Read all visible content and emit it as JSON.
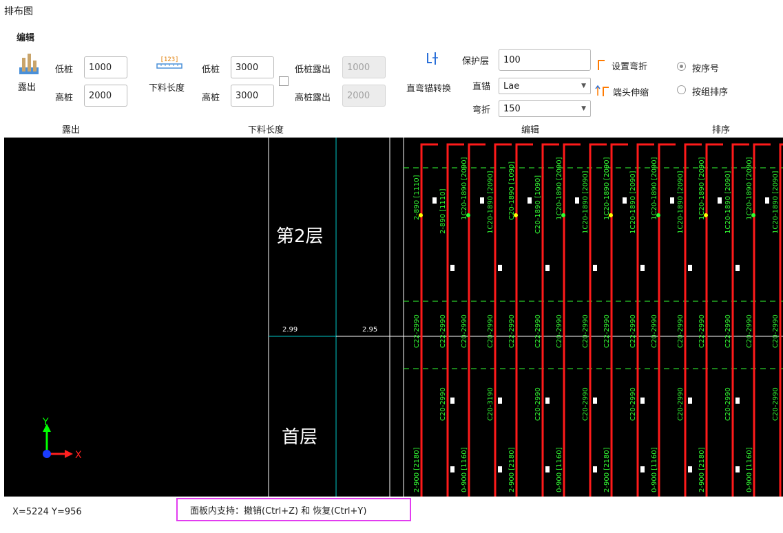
{
  "window": {
    "title": "排布图"
  },
  "ribbon": {
    "tab_label": "编辑",
    "expose_group": {
      "button_label": "露出",
      "low_pile_label": "低桩",
      "low_pile_value": "1000",
      "high_pile_label": "高桩",
      "high_pile_value": "2000",
      "caption": "露出"
    },
    "cut_length_group": {
      "button_label": "下料长度",
      "icon_digits": "[123]",
      "low_pile_label": "低桩",
      "low_pile_value": "3000",
      "high_pile_label": "高桩",
      "high_pile_value": "3000",
      "low_expose_label": "低桩露出",
      "low_expose_value": "1000",
      "high_expose_label": "高桩露出",
      "high_expose_value": "2000",
      "caption": "下料长度"
    },
    "edit_group": {
      "convert_label": "直弯锚转换",
      "cover_label": "保护层",
      "cover_value": "100",
      "straight_anchor_label": "直锚",
      "straight_anchor_value": "Lae",
      "bend_label": "弯折",
      "bend_value": "150",
      "set_bend_label": "设置弯折",
      "end_stretch_label": "端头伸缩",
      "caption": "编辑"
    },
    "sort_group": {
      "option_by_number": "按序号",
      "option_by_group": "按组排序",
      "selected": "按序号",
      "caption": "排序"
    }
  },
  "canvas": {
    "floor_upper": "第2层",
    "floor_lower": "首层",
    "elev_left": "2.99",
    "elev_right": "2.95",
    "axis_x": "X",
    "axis_y": "Y",
    "colors": {
      "bar": "#ff1a1a",
      "text": "#33ff33",
      "grid": "#ffffff",
      "axis": "#00c8c8",
      "marker": "#ffff00"
    },
    "upper_labels": [
      "2-890 [1110]",
      "1C20-1890 [2090]",
      "C20-1890 [1090]",
      "1C20-1890 [2090]",
      "1C20-1890 [2090]",
      "1C20-1890 [2090]",
      "1C20-1890 [2090]",
      "1C20-1890 [2090]"
    ],
    "mid_labels": [
      "C22-2990",
      "C20-2990",
      "C22-2990",
      "C20-2990",
      "C22-2990",
      "C20-2990",
      "C22-2990",
      "C20-2990"
    ],
    "lower_labels": [
      "C20-2990",
      "C20-3190",
      "C20-2990",
      "C20-2990",
      "C20-2990",
      "C20-2990",
      "C20-2990",
      "C20-2990"
    ],
    "bottom_labels": [
      "2-900 [2180]",
      "0-900 [1160]",
      "2-900 [2180]",
      "0-900 [1160]",
      "2-900 [2180]",
      "0-900 [1160]",
      "2-900 [2180]",
      "0-900 [1160]"
    ]
  },
  "status": {
    "coords": "X=5224 Y=956",
    "tip": "面板内支持：撤销(Ctrl+Z) 和 恢复(Ctrl+Y)"
  }
}
